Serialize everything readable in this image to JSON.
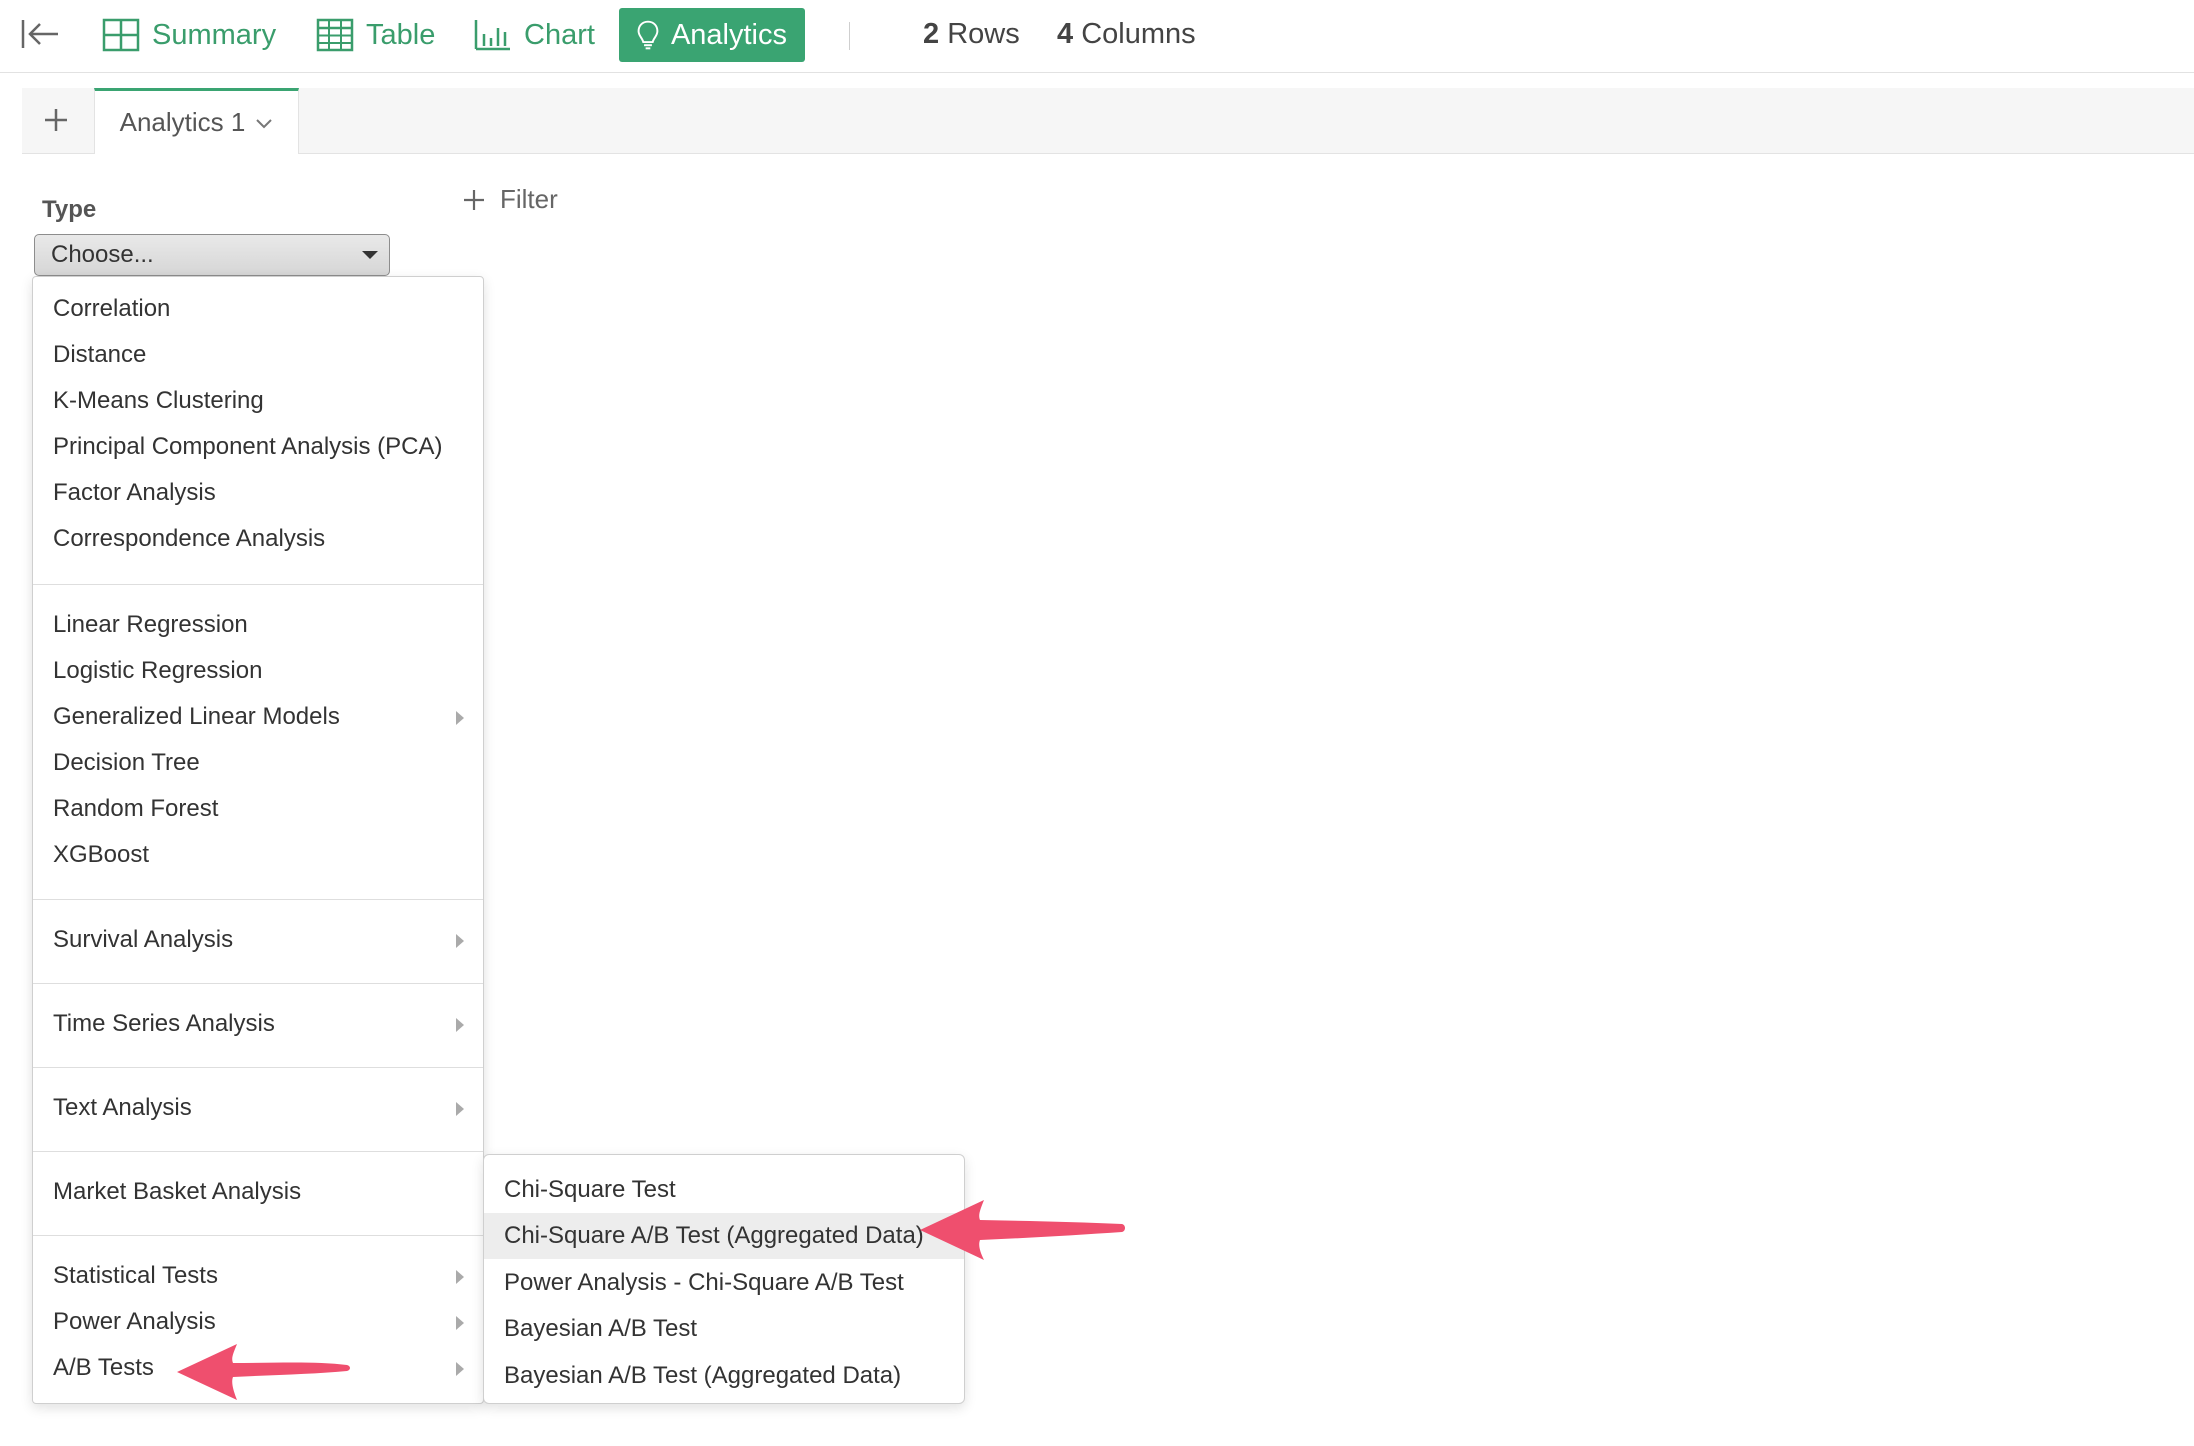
{
  "toolbar": {
    "summary_label": "Summary",
    "table_label": "Table",
    "chart_label": "Chart",
    "analytics_label": "Analytics",
    "rows_count": "2",
    "rows_label": "Rows",
    "columns_count": "4",
    "columns_label": "Columns"
  },
  "tabs": {
    "active_label": "Analytics 1"
  },
  "type": {
    "label": "Type",
    "selected": "Choose..."
  },
  "filter": {
    "label": "Filter"
  },
  "menu": {
    "items": [
      "Correlation",
      "Distance",
      "K-Means Clustering",
      "Principal Component Analysis (PCA)",
      "Factor Analysis",
      "Correspondence Analysis",
      "Linear Regression",
      "Logistic Regression",
      "Generalized Linear Models",
      "Decision Tree",
      "Random Forest",
      "XGBoost",
      "Survival Analysis",
      "Time Series Analysis",
      "Text Analysis",
      "Market Basket Analysis",
      "Statistical Tests",
      "Power Analysis",
      "A/B Tests"
    ]
  },
  "submenu": {
    "items": [
      "Chi-Square Test",
      "Chi-Square A/B Test (Aggregated Data)",
      "Power Analysis - Chi-Square A/B Test",
      "Bayesian A/B Test",
      "Bayesian A/B Test (Aggregated Data)"
    ]
  },
  "colors": {
    "accent": "#3aa472",
    "annotation_arrow": "#ef4f6e"
  }
}
